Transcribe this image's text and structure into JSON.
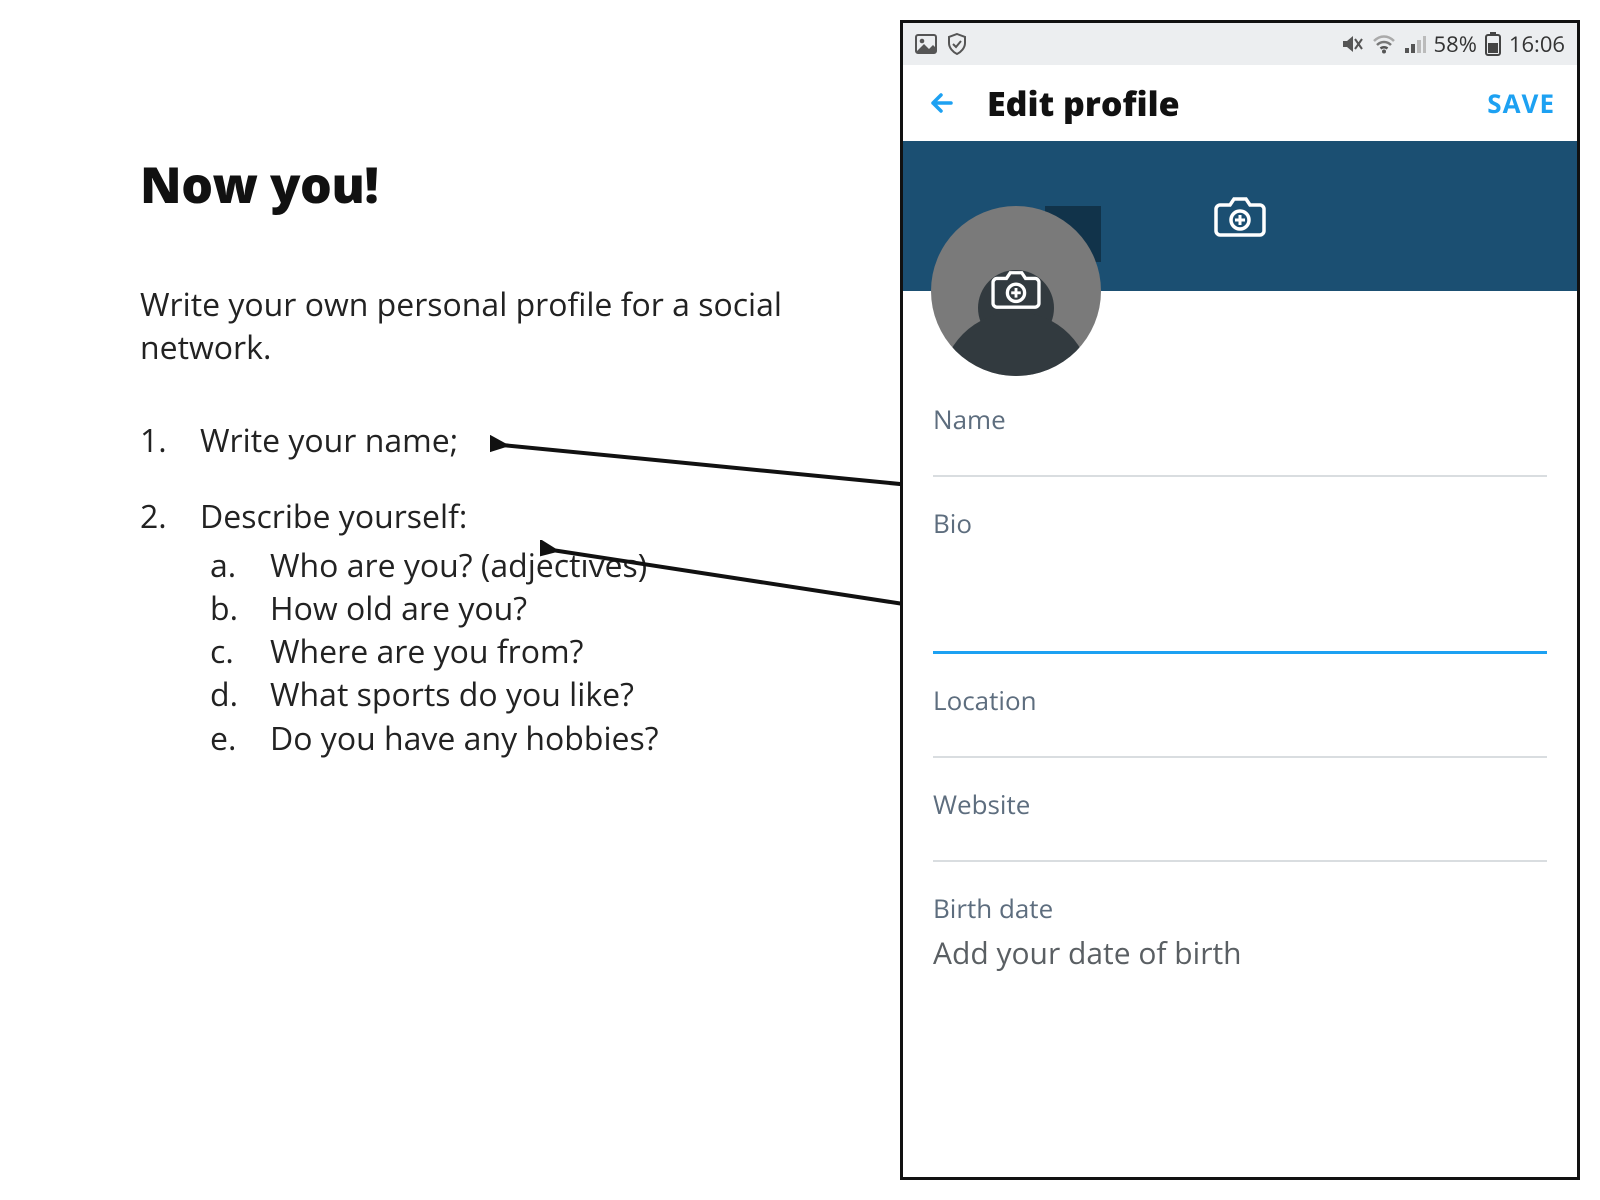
{
  "left": {
    "heading": "Now you!",
    "intro": "Write your own personal profile for a social network.",
    "items": [
      {
        "text": "Write your name;"
      },
      {
        "text": "Describe yourself:",
        "sub": [
          "Who are you? (adjectives)",
          "How old are you?",
          "Where are you from?",
          "What sports do you like?",
          "Do you have any hobbies?"
        ]
      }
    ]
  },
  "phone": {
    "status": {
      "battery_pct": "58%",
      "time": "16:06"
    },
    "appbar": {
      "title": "Edit profile",
      "save": "SAVE"
    },
    "fields": {
      "name": {
        "label": "Name"
      },
      "bio": {
        "label": "Bio"
      },
      "location": {
        "label": "Location"
      },
      "website": {
        "label": "Website"
      },
      "birthdate": {
        "label": "Birth date",
        "placeholder": "Add your date of birth"
      }
    }
  }
}
